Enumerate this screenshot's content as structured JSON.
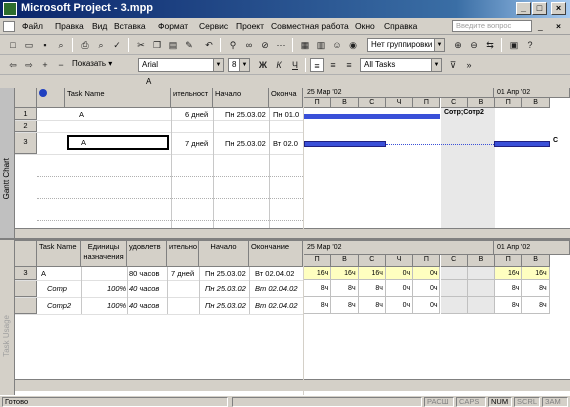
{
  "window": {
    "title": "Microsoft Project - 3.mpp",
    "min": "_",
    "max": "□",
    "close": "×"
  },
  "menu": {
    "items": [
      "Файл",
      "Правка",
      "Вид",
      "Вставка",
      "Формат",
      "Сервис",
      "Проект",
      "Совместная работа",
      "Окно",
      "Справка"
    ],
    "help_placeholder": "Введите вопрос",
    "doc_min": "_",
    "doc_close": "×"
  },
  "toolbar1": {
    "group_combo": "Нет группировки"
  },
  "toolbar2": {
    "show_label": "Показать",
    "font": "Arial",
    "size": "8",
    "bold": "Ж",
    "italic": "К",
    "underline": "Ч",
    "filter": "All Tasks"
  },
  "entry": {
    "value": "А"
  },
  "gantt": {
    "view_label": "Gantt Chart",
    "columns": [
      "Task Name",
      "ительност",
      "Начало",
      "Оконча"
    ],
    "rows": [
      {
        "id": "1",
        "name": "А",
        "duration": "6 дней",
        "start": "Пн 25.03.02",
        "finish": "Пн 01.0"
      },
      {
        "id": "2",
        "name": "",
        "duration": "",
        "start": "",
        "finish": ""
      },
      {
        "id": "3",
        "name": "А",
        "duration": "7 дней",
        "start": "Пн 25.03.02",
        "finish": "Вт 02.0"
      }
    ],
    "timescale": {
      "week1": "25 Мар '02",
      "week2": "01 Апр '02",
      "days": [
        "П",
        "В",
        "С",
        "Ч",
        "П",
        "С",
        "В",
        "П",
        "В"
      ]
    },
    "bar_label": "Сотр;Сотр2",
    "bar_label2": "С"
  },
  "usage": {
    "view_label": "Task Usage",
    "columns": [
      "Task Name",
      "Единицы назначения",
      "удовлетв",
      "ительно",
      "Начало",
      "Окончание"
    ],
    "rows": [
      {
        "id": "3",
        "name": "А",
        "units": "",
        "work": "80 часов",
        "duration": "7 дней",
        "start": "Пн 25.03.02",
        "finish": "Вт 02.04.02"
      },
      {
        "id": "",
        "name": "Сотр",
        "units": "100%",
        "work": "40 часов",
        "duration": "",
        "start": "Пн 25.03.02",
        "finish": "Вт 02.04.02"
      },
      {
        "id": "",
        "name": "Сотр2",
        "units": "100%",
        "work": "40 часов",
        "duration": "",
        "start": "Пн 25.03.02",
        "finish": "Вт 02.04.02"
      }
    ],
    "timescale": {
      "week1": "25 Мар '02",
      "week2": "01 Апр '02",
      "days": [
        "П",
        "В",
        "С",
        "Ч",
        "П",
        "С",
        "В",
        "П",
        "В"
      ]
    },
    "grid": [
      [
        "16ч",
        "16ч",
        "16ч",
        "0ч",
        "0ч",
        "",
        "",
        "16ч",
        "16ч"
      ],
      [
        "8ч",
        "8ч",
        "8ч",
        "0ч",
        "0ч",
        "",
        "",
        "8ч",
        "8ч"
      ],
      [
        "8ч",
        "8ч",
        "8ч",
        "0ч",
        "0ч",
        "",
        "",
        "8ч",
        "8ч"
      ]
    ]
  },
  "status": {
    "ready": "Готово",
    "ext": "РАСШ",
    "caps": "CAPS",
    "num": "NUM",
    "scrl": "SCRL",
    "ovr": "ЗАМ"
  }
}
